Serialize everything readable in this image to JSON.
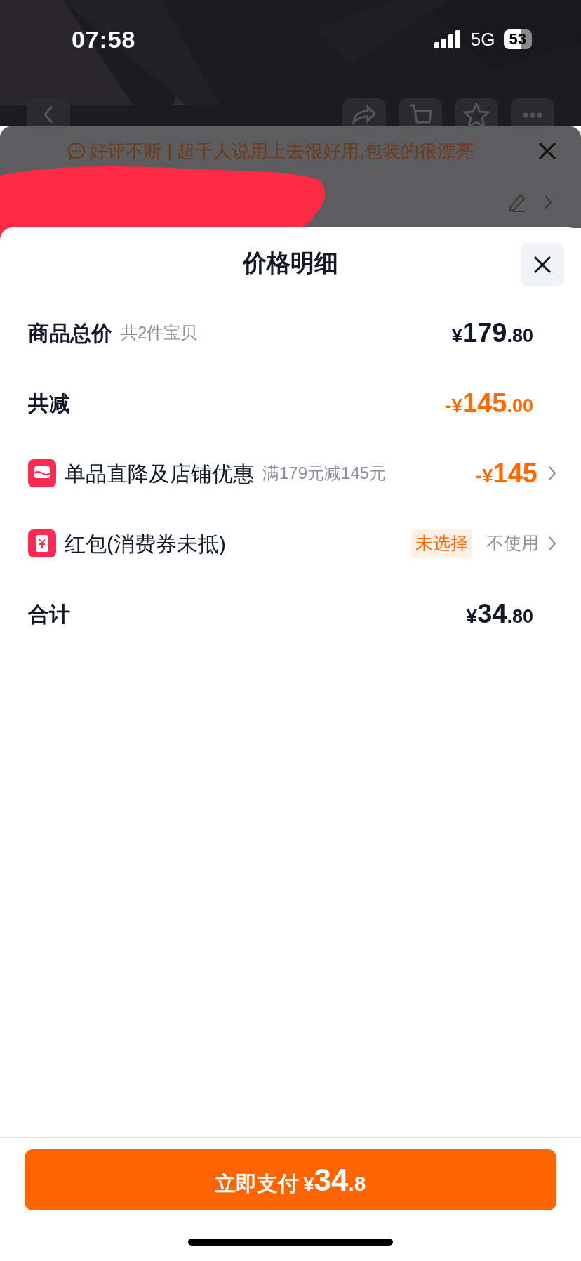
{
  "status_bar": {
    "time": "07:58",
    "network": "5G",
    "battery": "53"
  },
  "banner": {
    "text": "好评不断 | 超千人说用上去很好用,包装的很漂亮"
  },
  "sheet": {
    "title": "价格明细"
  },
  "rows": [
    {
      "kind": "subtotal",
      "label": "商品总价",
      "note": "共2件宝贝",
      "amount": {
        "currency": "¥",
        "integer": "179",
        "fraction": ".80"
      }
    },
    {
      "kind": "reduction",
      "label": "共减",
      "amount": {
        "currency": "-¥",
        "integer": "145",
        "fraction": ".00"
      }
    },
    {
      "kind": "promo",
      "label": "单品直降及店铺优惠",
      "note": "满179元减145元",
      "amount": {
        "currency": "-¥",
        "integer": "145"
      }
    },
    {
      "kind": "coupon",
      "label": "红包(消费券未抵)",
      "badge": "未选择",
      "action": "不使用"
    },
    {
      "kind": "total",
      "label": "合计",
      "amount": {
        "currency": "¥",
        "integer": "34",
        "fraction": ".80"
      }
    }
  ],
  "pay_button": {
    "label": "立即支付",
    "currency": "¥",
    "integer": "34",
    "fraction": ".8"
  }
}
